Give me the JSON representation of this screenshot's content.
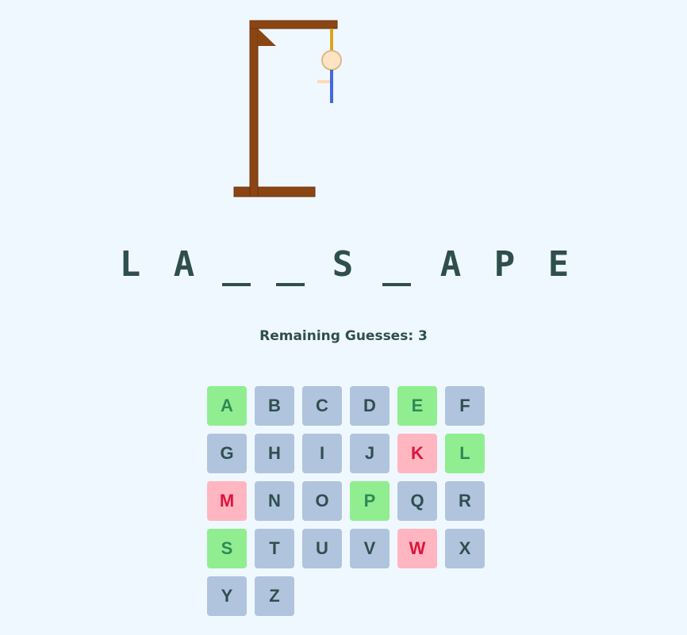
{
  "word_display": [
    {
      "char": "L",
      "revealed": true
    },
    {
      "char": "A",
      "revealed": true
    },
    {
      "char": "",
      "revealed": false
    },
    {
      "char": "",
      "revealed": false
    },
    {
      "char": "S",
      "revealed": true
    },
    {
      "char": "",
      "revealed": false
    },
    {
      "char": "A",
      "revealed": true
    },
    {
      "char": "P",
      "revealed": true
    },
    {
      "char": "E",
      "revealed": true
    }
  ],
  "status": {
    "remaining_text": "Remaining Guesses: 3"
  },
  "keyboard": {
    "keys": [
      {
        "letter": "A",
        "state": "correct"
      },
      {
        "letter": "B",
        "state": "unused"
      },
      {
        "letter": "C",
        "state": "unused"
      },
      {
        "letter": "D",
        "state": "unused"
      },
      {
        "letter": "E",
        "state": "correct"
      },
      {
        "letter": "F",
        "state": "unused"
      },
      {
        "letter": "G",
        "state": "unused"
      },
      {
        "letter": "H",
        "state": "unused"
      },
      {
        "letter": "I",
        "state": "unused"
      },
      {
        "letter": "J",
        "state": "unused"
      },
      {
        "letter": "K",
        "state": "wrong"
      },
      {
        "letter": "L",
        "state": "correct"
      },
      {
        "letter": "M",
        "state": "wrong"
      },
      {
        "letter": "N",
        "state": "unused"
      },
      {
        "letter": "O",
        "state": "unused"
      },
      {
        "letter": "P",
        "state": "correct"
      },
      {
        "letter": "Q",
        "state": "unused"
      },
      {
        "letter": "R",
        "state": "unused"
      },
      {
        "letter": "S",
        "state": "correct"
      },
      {
        "letter": "T",
        "state": "unused"
      },
      {
        "letter": "U",
        "state": "unused"
      },
      {
        "letter": "V",
        "state": "unused"
      },
      {
        "letter": "W",
        "state": "wrong"
      },
      {
        "letter": "X",
        "state": "unused"
      },
      {
        "letter": "Y",
        "state": "unused"
      },
      {
        "letter": "Z",
        "state": "unused"
      }
    ]
  },
  "hangman": {
    "parts_shown": [
      "rope",
      "head",
      "body",
      "arm"
    ]
  },
  "colors": {
    "background": "#f0f8ff",
    "text": "#2f4f4f",
    "key_unused": "#b0c4de",
    "key_correct_bg": "#90ee90",
    "key_correct_text": "#2e8b57",
    "key_wrong_bg": "#ffb6c1",
    "key_wrong_text": "#dc143c",
    "gallows_wood": "#8b4513",
    "rope": "#daa520",
    "head_fill": "#ffe4c4",
    "head_stroke": "#deb887",
    "body": "#4169e1"
  }
}
